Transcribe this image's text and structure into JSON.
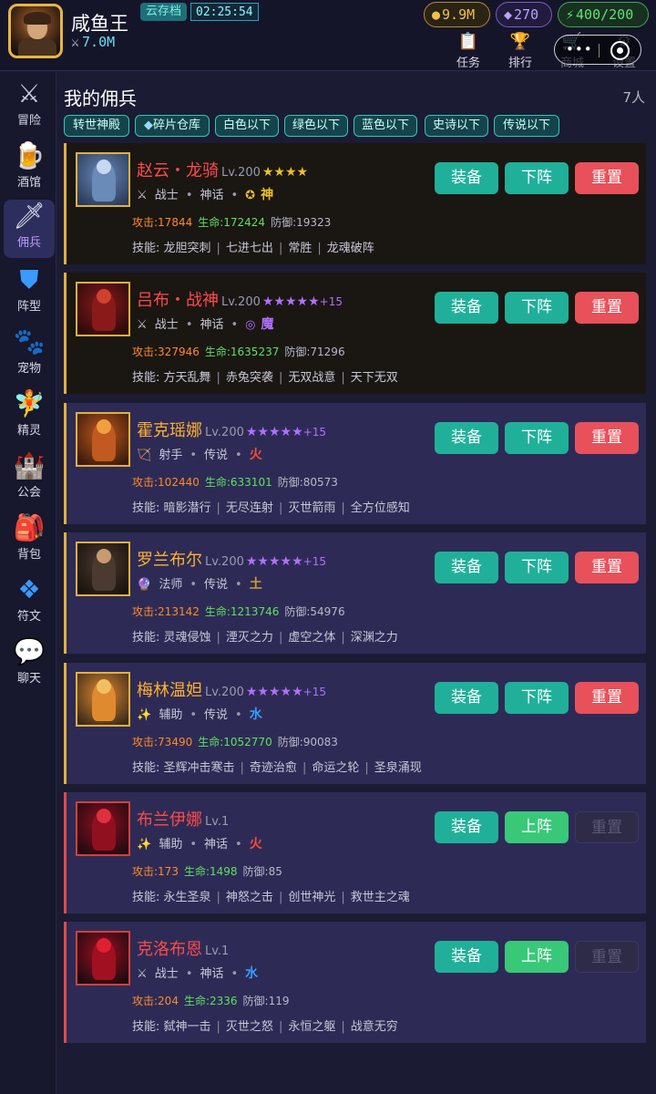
{
  "player": {
    "name": "咸鱼王",
    "cloud_label": "云存档",
    "timer": "02:25:54",
    "power_icon": "crossed-swords-icon",
    "power": "7.0M"
  },
  "resources": {
    "gold": "9.9M",
    "gems": "270",
    "energy": "400/200"
  },
  "top_nav": [
    {
      "icon": "clipboard-icon",
      "label": "任务"
    },
    {
      "icon": "trophy-icon",
      "label": "排行"
    },
    {
      "icon": "cart-icon",
      "label": "商城"
    },
    {
      "icon": "gear-icon",
      "label": "设置"
    }
  ],
  "sidebar": [
    {
      "icon": "swords-icon",
      "label": "冒险"
    },
    {
      "icon": "beer-icon",
      "label": "酒馆"
    },
    {
      "icon": "dagger-icon",
      "label": "佣兵",
      "active": true
    },
    {
      "icon": "shield-icon",
      "label": "阵型"
    },
    {
      "icon": "paw-icon",
      "label": "宠物"
    },
    {
      "icon": "fairy-icon",
      "label": "精灵"
    },
    {
      "icon": "castle-icon",
      "label": "公会"
    },
    {
      "icon": "backpack-icon",
      "label": "背包"
    },
    {
      "icon": "rune-icon",
      "label": "符文"
    },
    {
      "icon": "speech-bubble-icon",
      "label": "聊天"
    }
  ],
  "page": {
    "title": "我的佣兵",
    "count": "7人"
  },
  "filters": [
    "转世神殿",
    "碎片仓库",
    "白色以下",
    "绿色以下",
    "蓝色以下",
    "史诗以下",
    "传说以下"
  ],
  "buttons": {
    "equip": "装备",
    "unassign": "下阵",
    "assign": "上阵",
    "reset": "重置"
  },
  "heroes": [
    {
      "name": "赵云・龙骑",
      "name_color": "#ff4a4a",
      "level": "Lv.200",
      "stars": "★★★★",
      "star_color": "gold",
      "plus": "",
      "role_icon": "crossed-swords-icon",
      "role": "战士",
      "rarity": "神话",
      "element_icon": "sun-icon",
      "element": "神",
      "element_color": "#f0c020",
      "atk": "攻击:17844",
      "hp": "生命:172424",
      "def": "防御:19323",
      "skills_label": "技能:",
      "skills": [
        "龙胆突刺",
        "七进七出",
        "常胜",
        "龙魂破阵"
      ],
      "deployed": true
    },
    {
      "name": "吕布・战神",
      "name_color": "#ff4a4a",
      "level": "Lv.200",
      "stars": "★★★★★",
      "star_color": "purple",
      "plus": "+15",
      "role_icon": "crossed-swords-icon",
      "role": "战士",
      "rarity": "神话",
      "element_icon": "vortex-icon",
      "element": "魔",
      "element_color": "#b070ff",
      "atk": "攻击:327946",
      "hp": "生命:1635237",
      "def": "防御:71296",
      "skills_label": "技能:",
      "skills": [
        "方天乱舞",
        "赤兔突袭",
        "无双战意",
        "天下无双"
      ],
      "deployed": true
    },
    {
      "name": "霍克瑶娜",
      "name_color": "#ffb030",
      "level": "Lv.200",
      "stars": "★★★★★",
      "star_color": "purple",
      "plus": "+15",
      "role_icon": "bow-icon",
      "role": "射手",
      "rarity": "传说",
      "element_icon": "",
      "element": "火",
      "element_color": "#ff4a3a",
      "atk": "攻击:102440",
      "hp": "生命:633101",
      "def": "防御:80573",
      "skills_label": "技能:",
      "skills": [
        "暗影潜行",
        "无尽连射",
        "灭世箭雨",
        "全方位感知"
      ],
      "deployed": true
    },
    {
      "name": "罗兰布尔",
      "name_color": "#ffb030",
      "level": "Lv.200",
      "stars": "★★★★★",
      "star_color": "purple",
      "plus": "+15",
      "role_icon": "orb-icon",
      "role": "法师",
      "rarity": "传说",
      "element_icon": "",
      "element": "土",
      "element_color": "#d09a3a",
      "atk": "攻击:213142",
      "hp": "生命:1213746",
      "def": "防御:54976",
      "skills_label": "技能:",
      "skills": [
        "灵魂侵蚀",
        "湮灭之力",
        "虚空之体",
        "深渊之力"
      ],
      "deployed": true
    },
    {
      "name": "梅林温妲",
      "name_color": "#ffb030",
      "level": "Lv.200",
      "stars": "★★★★★",
      "star_color": "purple",
      "plus": "+15",
      "role_icon": "sparkle-icon",
      "role": "辅助",
      "rarity": "传说",
      "element_icon": "",
      "element": "水",
      "element_color": "#3a9aff",
      "atk": "攻击:73490",
      "hp": "生命:1052770",
      "def": "防御:90083",
      "skills_label": "技能:",
      "skills": [
        "圣辉冲击寒击",
        "奇迹治愈",
        "命运之轮",
        "圣泉涌现"
      ],
      "deployed": true
    },
    {
      "name": "布兰伊娜",
      "name_color": "#ff4a4a",
      "level": "Lv.1",
      "stars": "",
      "star_color": "gold",
      "plus": "",
      "role_icon": "sparkle-icon",
      "role": "辅助",
      "rarity": "神话",
      "element_icon": "",
      "element": "火",
      "element_color": "#ff4a3a",
      "atk": "攻击:173",
      "hp": "生命:1498",
      "def": "防御:85",
      "skills_label": "技能:",
      "skills": [
        "永生圣泉",
        "神怒之击",
        "创世神光",
        "救世主之魂"
      ],
      "deployed": false
    },
    {
      "name": "克洛布恩",
      "name_color": "#ff4a4a",
      "level": "Lv.1",
      "stars": "",
      "star_color": "gold",
      "plus": "",
      "role_icon": "crossed-swords-icon",
      "role": "战士",
      "rarity": "神话",
      "element_icon": "",
      "element": "水",
      "element_color": "#3a9aff",
      "atk": "攻击:204",
      "hp": "生命:2336",
      "def": "防御:119",
      "skills_label": "技能:",
      "skills": [
        "弑神一击",
        "灭世之怒",
        "永恒之躯",
        "战意无穷"
      ],
      "deployed": false
    }
  ]
}
